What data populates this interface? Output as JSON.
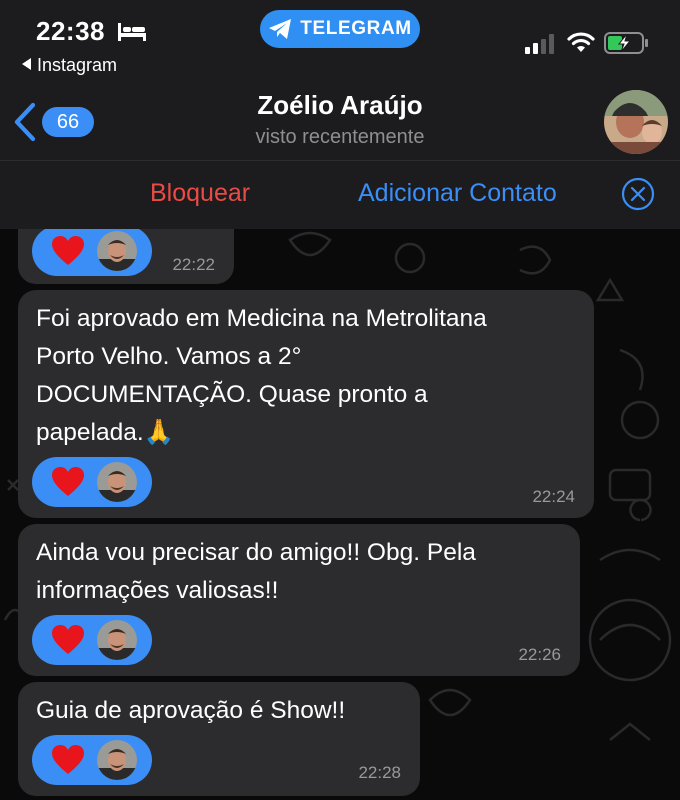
{
  "status_bar": {
    "time": "22:38",
    "back_app": "Instagram",
    "app_pill": "TELEGRAM",
    "icons": [
      "bed-icon",
      "signal-icon",
      "wifi-icon",
      "battery-charging-icon"
    ]
  },
  "header": {
    "back_count": "66",
    "title": "Zoélio Araújo",
    "subtitle": "visto recentemente"
  },
  "actions": {
    "block": "Bloquear",
    "add_contact": "Adicionar Contato"
  },
  "messages": [
    {
      "text": "",
      "time": "22:22",
      "reaction": "heart-icon"
    },
    {
      "text": "Foi aprovado em Medicina na Metrolitana\nPorto Velho.  Vamos a 2°\nDOCUMENTAÇÃO.  Quase pronto a\npapelada.🙏",
      "time": "22:24",
      "reaction": "heart-icon"
    },
    {
      "text": "Ainda vou precisar do amigo!! Obg. Pela\ninformações valiosas!!",
      "time": "22:26",
      "reaction": "heart-icon"
    },
    {
      "text": "Guia de aprovação é Show!!",
      "time": "22:28",
      "reaction": "heart-icon"
    }
  ],
  "colors": {
    "accent": "#3a8ef5",
    "destructive": "#ea4b44",
    "bubble": "#2c2c2e",
    "bar": "#1c1c1e",
    "secondary_text": "#8e8e93"
  }
}
